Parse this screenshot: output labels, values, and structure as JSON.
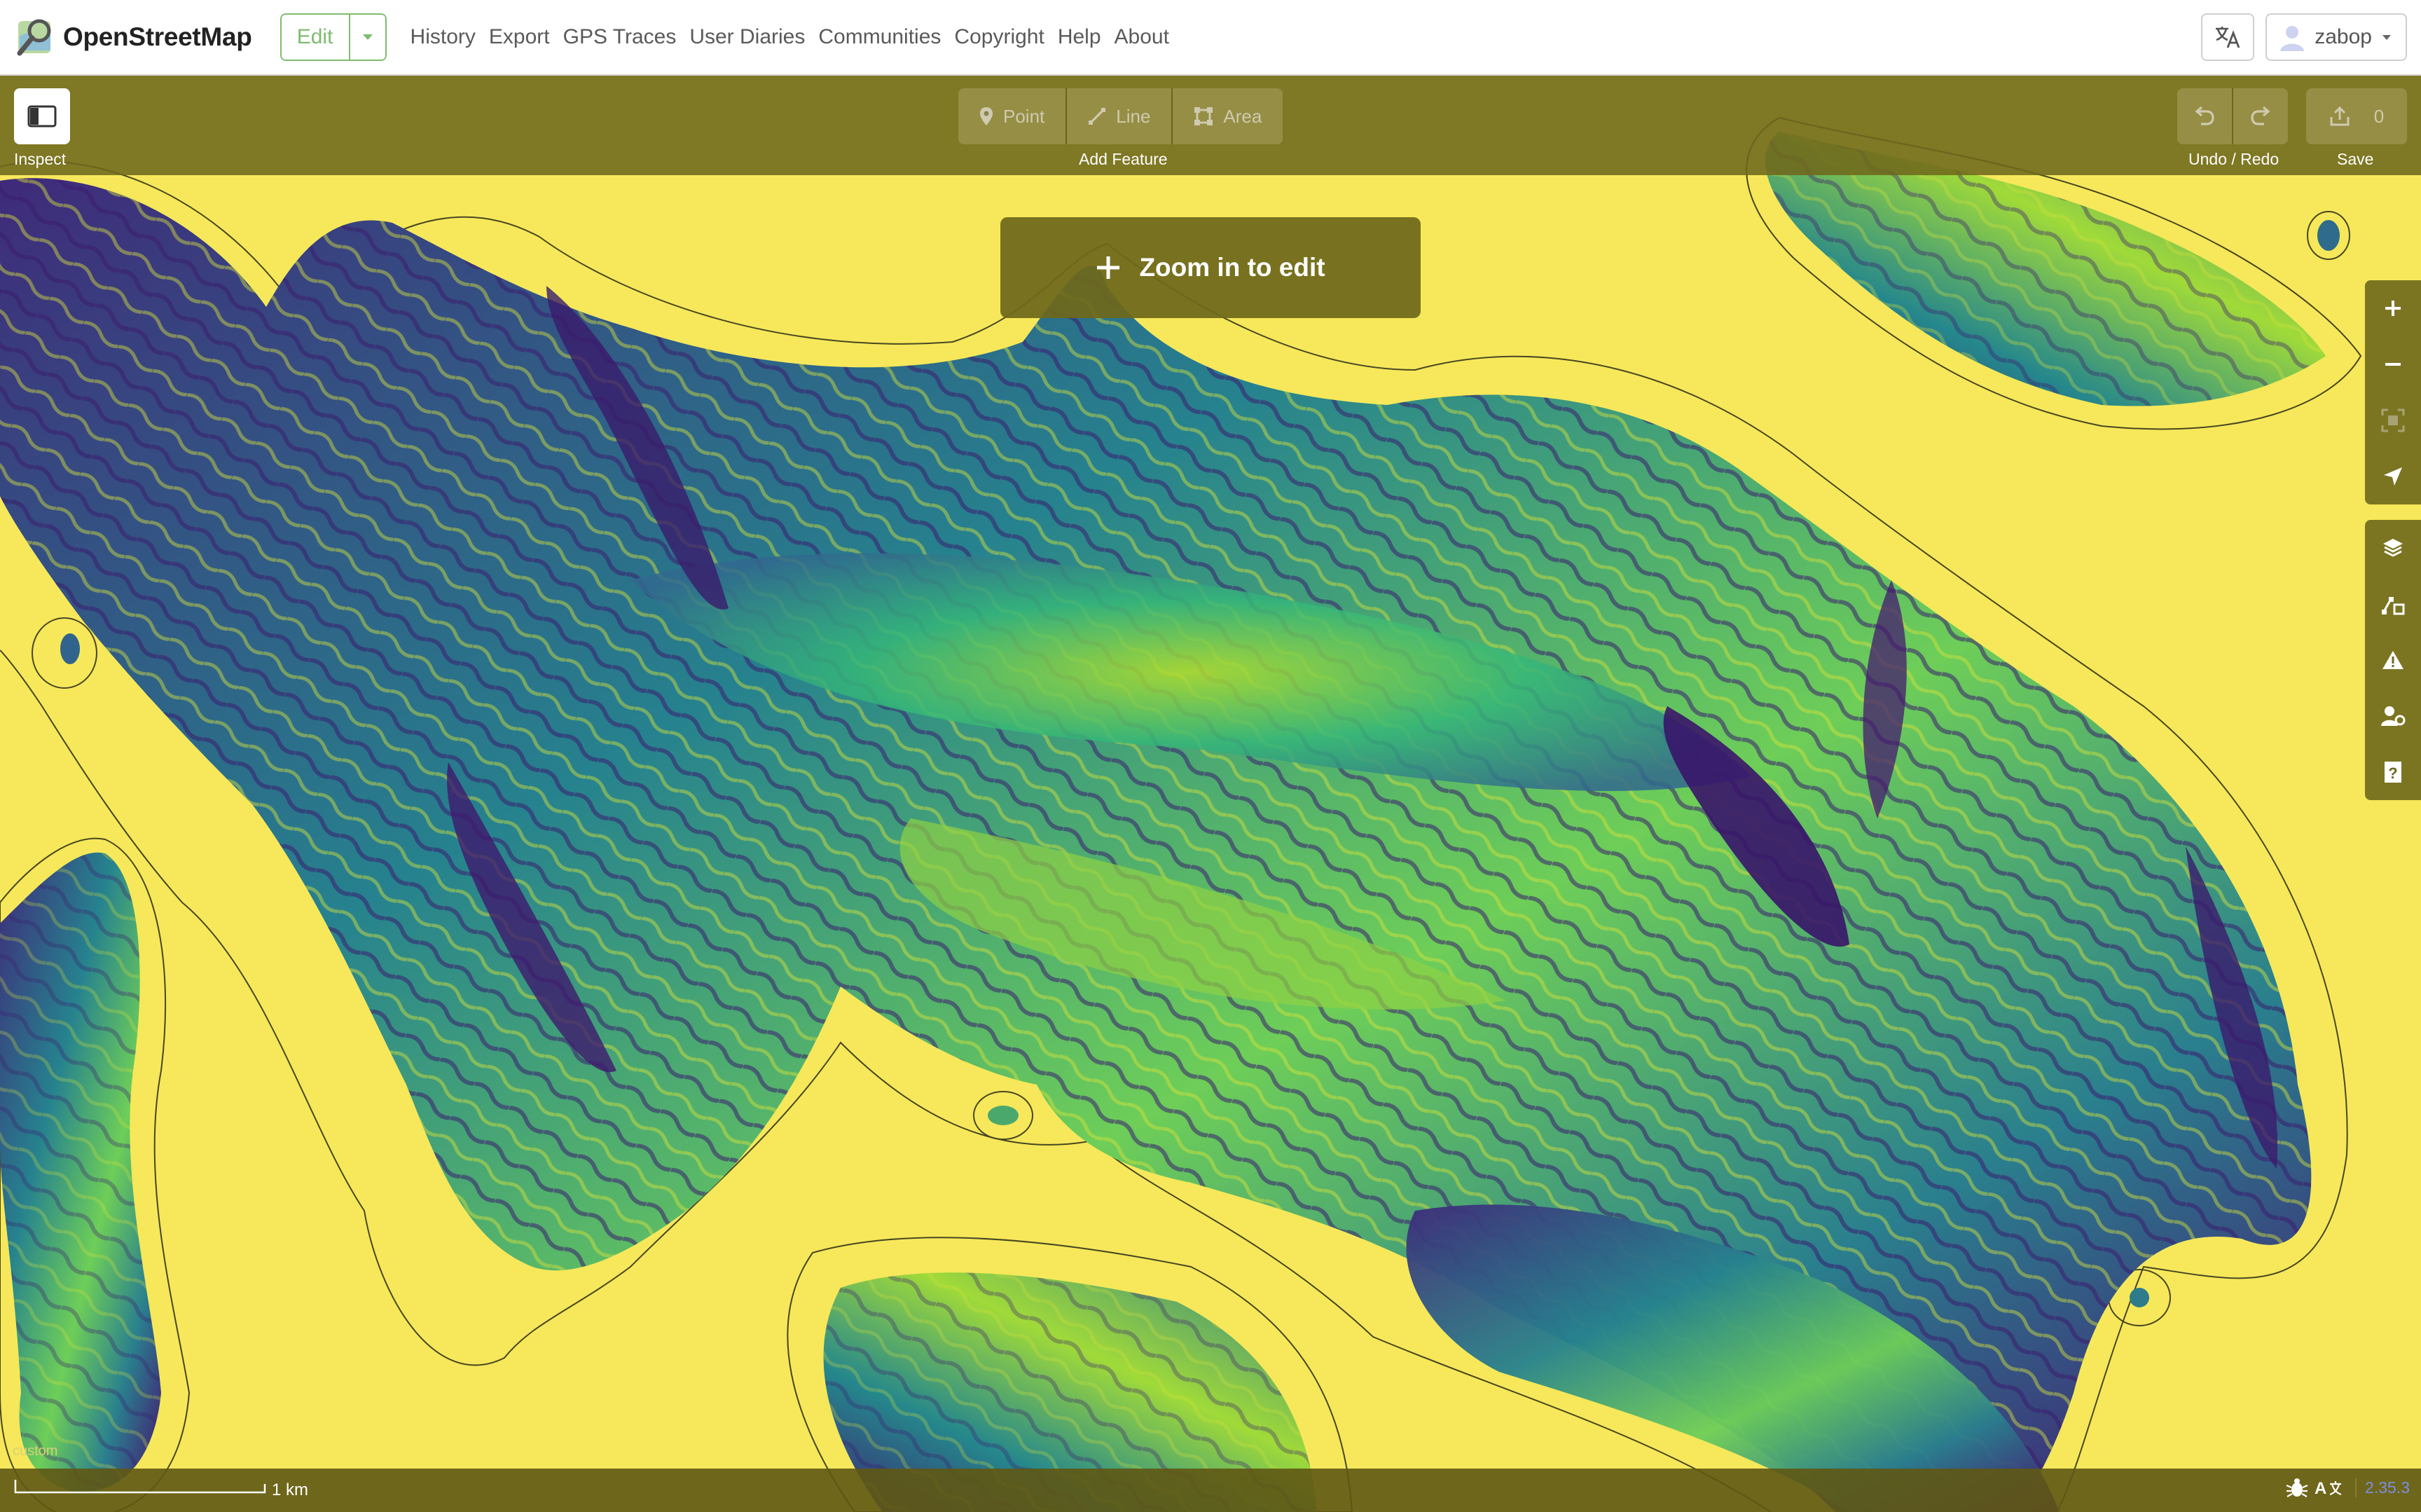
{
  "header": {
    "site_name": "OpenStreetMap",
    "edit_label": "Edit",
    "nav": [
      "History",
      "Export",
      "GPS Traces",
      "User Diaries",
      "Communities",
      "Copyright",
      "Help",
      "About"
    ],
    "username": "zabop"
  },
  "toolbar": {
    "inspect_label": "Inspect",
    "modes": [
      {
        "label": "Point",
        "icon": "point-icon"
      },
      {
        "label": "Line",
        "icon": "line-icon"
      },
      {
        "label": "Area",
        "icon": "area-icon"
      }
    ],
    "add_feature_label": "Add Feature",
    "undo_redo_label": "Undo / Redo",
    "save_label": "Save",
    "save_count": "0"
  },
  "banner": {
    "zoom_in_label": "Zoom in to edit"
  },
  "side_controls": {
    "map_controls": [
      "zoom-in-icon",
      "zoom-out-icon",
      "zoom-to-selection-icon",
      "geolocate-icon"
    ],
    "panels": [
      "background-layers-icon",
      "map-data-icon",
      "issues-icon",
      "preferences-icon",
      "help-icon"
    ]
  },
  "footer": {
    "scale_label": "1 km",
    "attribution": "custom",
    "version": "2.35.3"
  },
  "colors": {
    "map_yellow": "#f6e85a",
    "terrain_dark": "#3d1f6e",
    "terrain_teal": "#2d8f8a",
    "terrain_green": "#7cce4a",
    "toolbar": "#6e681c",
    "osm_green": "#7ebc6f"
  }
}
